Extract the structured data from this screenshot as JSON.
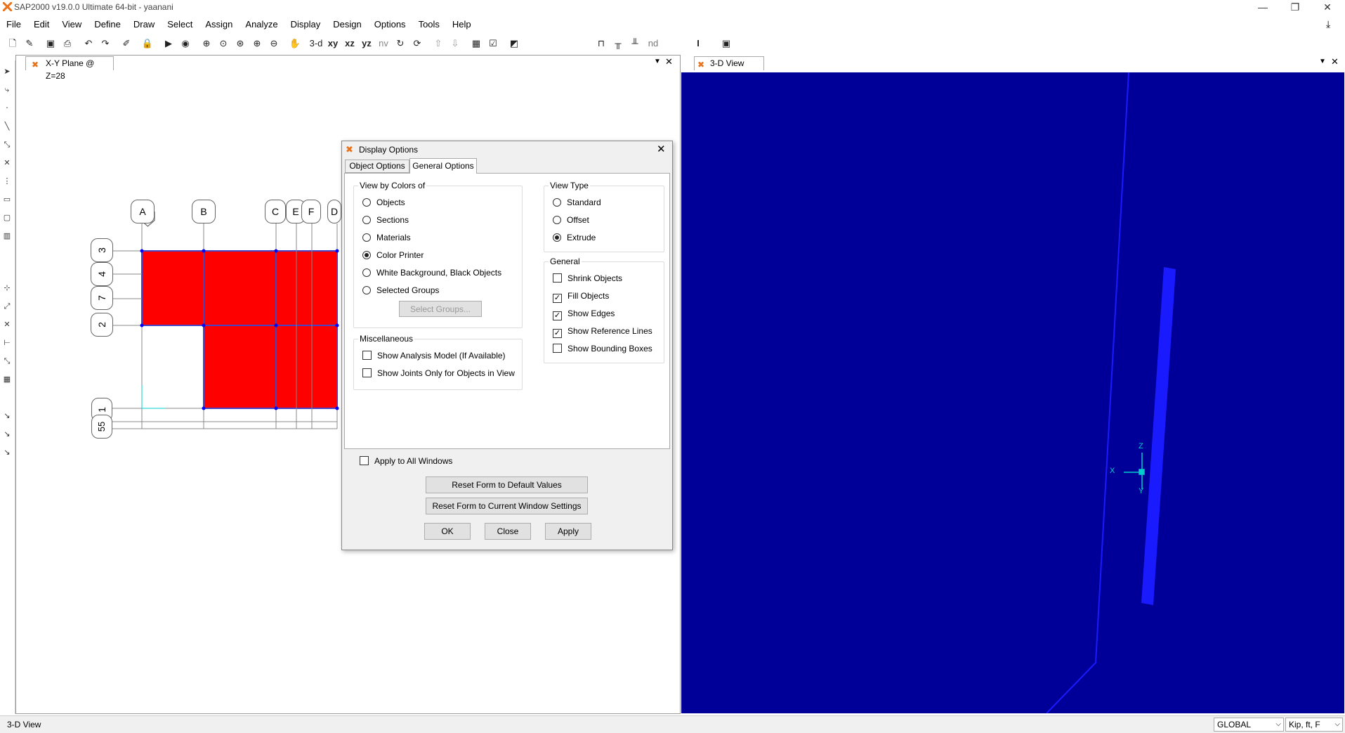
{
  "window": {
    "title": "SAP2000 v19.0.0 Ultimate 64-bit - yaanani",
    "minimize": "—",
    "restore": "❐",
    "close": "✕"
  },
  "menu": [
    "File",
    "Edit",
    "View",
    "Define",
    "Draw",
    "Select",
    "Assign",
    "Analyze",
    "Display",
    "Design",
    "Options",
    "Tools",
    "Help"
  ],
  "toolbar": {
    "view_3d": "3-d",
    "view_xy": "xy",
    "view_xz": "xz",
    "view_yz": "yz",
    "view_nv": "nv",
    "nd": "nd",
    "section_marker": "I"
  },
  "left_window": {
    "tab": "X-Y Plane @ Z=28",
    "grid_x": [
      "A",
      "B",
      "C",
      "E",
      "F",
      "D"
    ],
    "grid_y": [
      "3",
      "4",
      "7",
      "2",
      "1",
      "55"
    ],
    "fill_color": "#ff0000",
    "edge_color": "#0000ff"
  },
  "right_window": {
    "tab": "3-D View",
    "background": "#000099",
    "axis_x": "X",
    "axis_y": "Y",
    "axis_z": "Z"
  },
  "dialog": {
    "title": "Display Options",
    "tabs": [
      "Object Options",
      "General Options"
    ],
    "active_tab": "General Options",
    "view_by_colors": {
      "label": "View by Colors of",
      "options": [
        "Objects",
        "Sections",
        "Materials",
        "Color Printer",
        "White Background, Black Objects",
        "Selected Groups"
      ],
      "selected": "Color Printer",
      "select_groups_button": "Select Groups..."
    },
    "view_type": {
      "label": "View Type",
      "options": [
        "Standard",
        "Offset",
        "Extrude"
      ],
      "selected": "Extrude"
    },
    "misc": {
      "label": "Miscellaneous",
      "items": [
        {
          "label": "Show Analysis Model (If Available)",
          "checked": false
        },
        {
          "label": "Show Joints Only for Objects in View",
          "checked": false
        }
      ]
    },
    "general": {
      "label": "General",
      "items": [
        {
          "label": "Shrink Objects",
          "checked": false
        },
        {
          "label": "Fill Objects",
          "checked": true
        },
        {
          "label": "Show Edges",
          "checked": true
        },
        {
          "label": "Show Reference Lines",
          "checked": true
        },
        {
          "label": "Show Bounding Boxes",
          "checked": false
        }
      ]
    },
    "apply_all": {
      "label": "Apply to All Windows",
      "checked": false
    },
    "buttons": {
      "reset_default": "Reset Form to Default Values",
      "reset_current": "Reset Form to Current Window Settings",
      "ok": "OK",
      "close": "Close",
      "apply": "Apply"
    }
  },
  "status": {
    "left": "3-D View",
    "coord_system": "GLOBAL",
    "units": "Kip, ft, F"
  }
}
